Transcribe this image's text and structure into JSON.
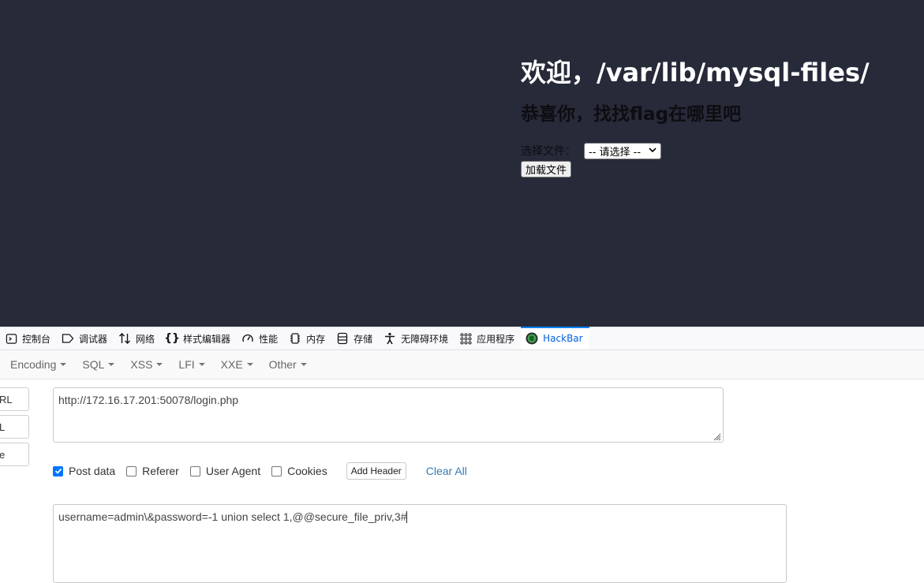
{
  "page": {
    "heading": "欢迎，/var/lib/mysql-files/",
    "subheading": "恭喜你，找找flag在哪里吧",
    "file_label": "选择文件：",
    "file_select_value": "-- 请选择 --",
    "load_button": "加载文件",
    "background_color": "#272a39"
  },
  "devtools_tabs": [
    {
      "label": "控制台",
      "icon": "console-icon"
    },
    {
      "label": "调试器",
      "icon": "debugger-icon"
    },
    {
      "label": "网络",
      "icon": "network-icon"
    },
    {
      "label": "样式编辑器",
      "icon": "style-editor-icon"
    },
    {
      "label": "性能",
      "icon": "performance-icon"
    },
    {
      "label": "内存",
      "icon": "memory-icon"
    },
    {
      "label": "存储",
      "icon": "storage-icon"
    },
    {
      "label": "无障碍环境",
      "icon": "accessibility-icon"
    },
    {
      "label": "应用程序",
      "icon": "application-icon"
    },
    {
      "label": "HackBar",
      "icon": "hackbar-icon",
      "active": true
    }
  ],
  "hackbar": {
    "menu": [
      "Encoding",
      "SQL",
      "XSS",
      "LFI",
      "XXE",
      "Other"
    ],
    "side_buttons": [
      "RL",
      "L",
      "e"
    ],
    "url_value": "http://172.16.17.201:50078/login.php",
    "options": [
      {
        "label": "Post data",
        "checked": true
      },
      {
        "label": "Referer",
        "checked": false
      },
      {
        "label": "User Agent",
        "checked": false
      },
      {
        "label": "Cookies",
        "checked": false
      }
    ],
    "add_header": "Add Header",
    "clear_all": "Clear All",
    "post_value": "username=admin\\&password=-1 union select 1,@@secure_file_priv,3#"
  }
}
